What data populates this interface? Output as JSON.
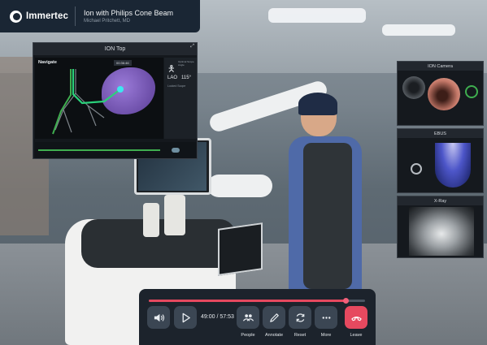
{
  "header": {
    "brand": "Immertec",
    "session_title": "Ion with Philips Cone Beam",
    "session_subtitle": "Michael Pritchett, MD"
  },
  "ion_panel": {
    "title": "ION Top",
    "mode": "Navigate",
    "timer": "00:36:46",
    "side_label": "Optimal Scope Angle",
    "view": "LAO",
    "angle": "115°",
    "lock_label": "Locked Scope"
  },
  "right_panels": {
    "camera": {
      "title": "ION Camera"
    },
    "ebus": {
      "title": "EBUS"
    },
    "xray": {
      "title": "X-Ray"
    }
  },
  "playback": {
    "progress": 0.91,
    "current_time": "49:00",
    "total_time": "57:53",
    "separator": " / "
  },
  "controls": {
    "people": "People",
    "annotate": "Annotate",
    "reset": "Reset",
    "more": "More",
    "leave": "Leave"
  },
  "colors": {
    "accent": "#e6495f",
    "bar_bg": "#1c232c",
    "button_bg": "#3b4653",
    "header_bg": "#1a2634",
    "nav_green": "#3fae4f"
  }
}
